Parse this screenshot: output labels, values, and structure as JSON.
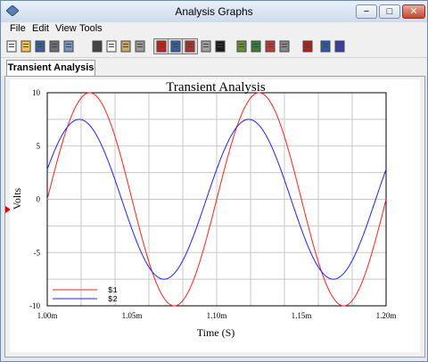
{
  "window": {
    "title": "Analysis Graphs",
    "min_glyph": "−",
    "max_glyph": "□",
    "close_glyph": "✕"
  },
  "menu": {
    "items": [
      "File",
      "Edit",
      "View",
      "Tools"
    ]
  },
  "toolbar": {
    "buttons": [
      {
        "name": "new-icon",
        "color": "#ffffff"
      },
      {
        "name": "open-folder-icon",
        "color": "#f2c44c"
      },
      {
        "name": "save-icon",
        "color": "#3b5f9a"
      },
      {
        "name": "print-icon",
        "color": "#6f6f6f"
      },
      {
        "name": "print-preview-icon",
        "color": "#7a93c0"
      },
      {
        "name": "cut-icon",
        "color": "#444444"
      },
      {
        "name": "copy-icon",
        "color": "#ffffff"
      },
      {
        "name": "paste-icon",
        "color": "#c9a86b"
      },
      {
        "name": "undo-icon",
        "color": "#9a9a9a"
      },
      {
        "name": "toggle-grid-icon",
        "color": "#d11a1a"
      },
      {
        "name": "toggle-legend-icon",
        "color": "#355fa0"
      },
      {
        "name": "show-cursors-icon",
        "color": "#b03030"
      },
      {
        "name": "zoom-icon",
        "color": "#a0a0a0"
      },
      {
        "name": "reverse-colors-icon",
        "color": "#1a1a1a"
      },
      {
        "name": "export-excel-icon",
        "color": "#6a8f3a"
      },
      {
        "name": "export-mathcad-icon",
        "color": "#3a7a3a"
      },
      {
        "name": "trace-color-icon",
        "color": "#c03a3a"
      },
      {
        "name": "overlay-traces-icon",
        "color": "#888888"
      },
      {
        "name": "select-marks-icon",
        "color": "#b82020"
      },
      {
        "name": "properties-icon",
        "color": "#2a5aa8"
      },
      {
        "name": "page-properties-icon",
        "color": "#3c3cb0"
      }
    ]
  },
  "tabs": [
    {
      "label": "Transient Analysis"
    }
  ],
  "chart_data": {
    "type": "line",
    "title": "Transient Analysis",
    "xlabel": "Time (S)",
    "ylabel": "Volts",
    "xlim": [
      0.001,
      0.0012
    ],
    "ylim": [
      -10,
      10
    ],
    "x_ticks": [
      "1.00m",
      "1.05m",
      "1.10m",
      "1.15m",
      "1.20m"
    ],
    "y_ticks": [
      "10",
      "5",
      "0",
      "-5",
      "-10"
    ],
    "grid": true,
    "legend_position": "bottom-left",
    "series": [
      {
        "name": "$1",
        "color": "#ff2020",
        "amplitude": 10,
        "frequency": 10000,
        "phase_deg": 0
      },
      {
        "name": "$2",
        "color": "#2020ff",
        "amplitude": 7.5,
        "frequency": 10000,
        "phase_deg": 22
      }
    ]
  }
}
